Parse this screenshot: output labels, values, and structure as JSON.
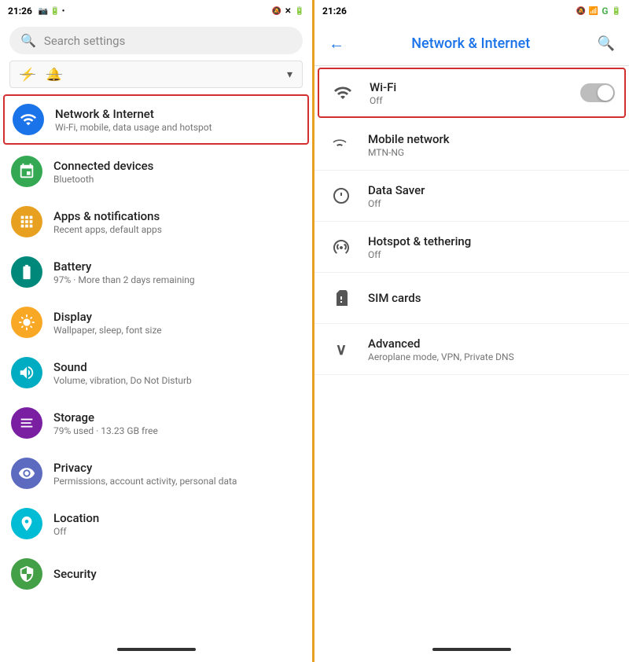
{
  "left": {
    "status": {
      "time": "21:26",
      "icons": [
        "🔕",
        "✕",
        "🔋"
      ]
    },
    "search": {
      "placeholder": "Search settings"
    },
    "filter": {
      "icons": [
        "⚡",
        "🔔"
      ]
    },
    "settings_items": [
      {
        "id": "network-internet",
        "icon_char": "📶",
        "icon_class": "icon-blue",
        "title": "Network & Internet",
        "subtitle": "Wi-Fi, mobile, data usage and hotspot",
        "highlighted": true
      },
      {
        "id": "connected-devices",
        "icon_char": "🔗",
        "icon_class": "icon-green",
        "title": "Connected devices",
        "subtitle": "Bluetooth",
        "highlighted": false
      },
      {
        "id": "apps-notifications",
        "icon_char": "⊞",
        "icon_class": "icon-orange",
        "title": "Apps & notifications",
        "subtitle": "Recent apps, default apps",
        "highlighted": false
      },
      {
        "id": "battery",
        "icon_char": "🔋",
        "icon_class": "icon-teal-dark",
        "title": "Battery",
        "subtitle": "97% · More than 2 days remaining",
        "highlighted": false
      },
      {
        "id": "display",
        "icon_char": "☀",
        "icon_class": "icon-amber",
        "title": "Display",
        "subtitle": "Wallpaper, sleep, font size",
        "highlighted": false
      },
      {
        "id": "sound",
        "icon_char": "🔊",
        "icon_class": "icon-teal",
        "title": "Sound",
        "subtitle": "Volume, vibration, Do Not Disturb",
        "highlighted": false
      },
      {
        "id": "storage",
        "icon_char": "≡",
        "icon_class": "icon-purple",
        "title": "Storage",
        "subtitle": "79% used · 13.23 GB free",
        "highlighted": false
      },
      {
        "id": "privacy",
        "icon_char": "👁",
        "icon_class": "icon-indigo",
        "title": "Privacy",
        "subtitle": "Permissions, account activity, personal data",
        "highlighted": false
      },
      {
        "id": "location",
        "icon_char": "📍",
        "icon_class": "icon-cyan",
        "title": "Location",
        "subtitle": "Off",
        "highlighted": false
      },
      {
        "id": "security",
        "icon_char": "🔒",
        "icon_class": "icon-green2",
        "title": "Security",
        "subtitle": "",
        "highlighted": false
      }
    ]
  },
  "right": {
    "status": {
      "time": "21:26",
      "icons": [
        "🔕",
        "📶",
        "G"
      ]
    },
    "header": {
      "title": "Network & Internet",
      "back_label": "←",
      "search_label": "🔍"
    },
    "items": [
      {
        "id": "wifi",
        "icon_char": "📶",
        "title": "Wi-Fi",
        "subtitle": "Off",
        "has_toggle": true,
        "toggle_on": false,
        "highlighted": true
      },
      {
        "id": "mobile-network",
        "icon_char": "▲",
        "title": "Mobile network",
        "subtitle": "MTN-NG",
        "has_toggle": false,
        "highlighted": false
      },
      {
        "id": "data-saver",
        "icon_char": "◯",
        "title": "Data Saver",
        "subtitle": "Off",
        "has_toggle": false,
        "highlighted": false
      },
      {
        "id": "hotspot-tethering",
        "icon_char": "📡",
        "title": "Hotspot & tethering",
        "subtitle": "Off",
        "has_toggle": false,
        "highlighted": false
      },
      {
        "id": "sim-cards",
        "icon_char": "📋",
        "title": "SIM cards",
        "subtitle": "",
        "has_toggle": false,
        "highlighted": false
      },
      {
        "id": "advanced",
        "icon_char": "∨",
        "title": "Advanced",
        "subtitle": "Aeroplane mode, VPN, Private DNS",
        "has_toggle": false,
        "highlighted": false
      }
    ]
  }
}
